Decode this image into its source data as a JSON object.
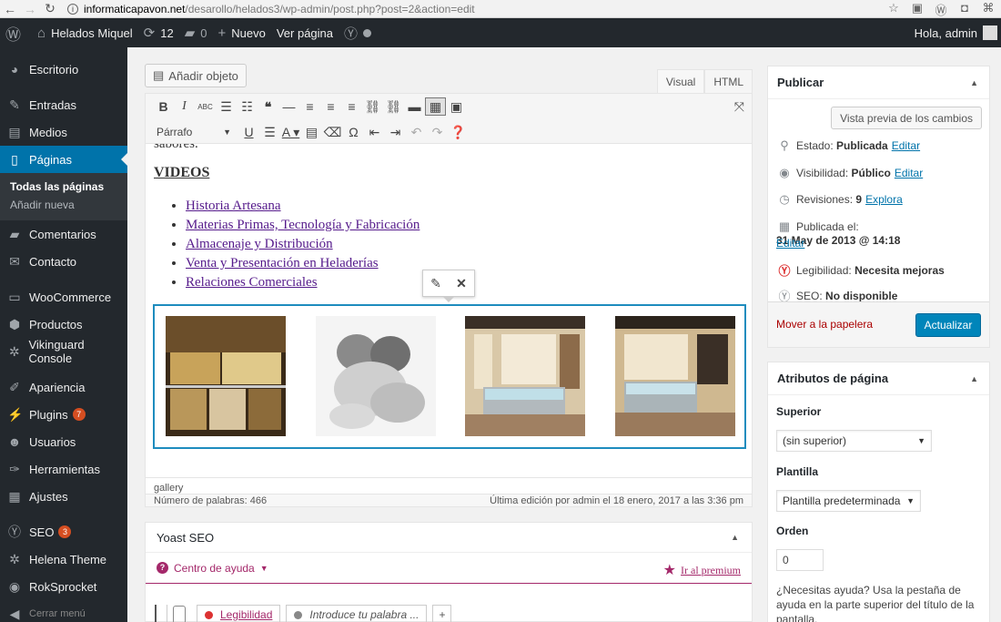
{
  "browser": {
    "url_host": "informaticapavon.net",
    "url_path": "/desarollo/helados3/wp-admin/post.php?post=2&action=edit"
  },
  "adminbar": {
    "site_name": "Helados Miquel",
    "updates_count": "12",
    "comments_count": "0",
    "new_label": "Nuevo",
    "view_page_label": "Ver página",
    "greeting": "Hola, admin"
  },
  "sidebar": {
    "items": [
      {
        "label": "Escritorio",
        "icon": "dashboard-icon"
      },
      {
        "label": "Entradas",
        "icon": "pin-icon"
      },
      {
        "label": "Medios",
        "icon": "media-icon"
      },
      {
        "label": "Páginas",
        "icon": "pages-icon"
      },
      {
        "label": "Comentarios",
        "icon": "comments-icon"
      },
      {
        "label": "Contacto",
        "icon": "mail-icon"
      },
      {
        "label": "WooCommerce",
        "icon": "woo-icon"
      },
      {
        "label": "Productos",
        "icon": "products-icon"
      },
      {
        "label": "Vikinguard Console",
        "icon": "gear-icon"
      },
      {
        "label": "Apariencia",
        "icon": "brush-icon"
      },
      {
        "label": "Plugins",
        "icon": "plugin-icon",
        "badge": "7"
      },
      {
        "label": "Usuarios",
        "icon": "users-icon"
      },
      {
        "label": "Herramientas",
        "icon": "tools-icon"
      },
      {
        "label": "Ajustes",
        "icon": "settings-icon"
      },
      {
        "label": "SEO",
        "icon": "yoast-icon",
        "badge": "3"
      },
      {
        "label": "Helena Theme",
        "icon": "gear-icon"
      },
      {
        "label": "RokSprocket",
        "icon": "rocket-icon"
      },
      {
        "label": "Cerrar menú",
        "icon": "collapse-icon"
      }
    ],
    "submenu": [
      "Todas las páginas",
      "Añadir nueva"
    ]
  },
  "editor": {
    "add_media_label": "Añadir objeto",
    "tab_visual": "Visual",
    "tab_html": "HTML",
    "format_select": "Párrafo",
    "cut_text": "sabores.",
    "heading": "VIDEOS",
    "links": [
      "Historia Artesana",
      "Materias Primas, Tecnología y Fabricación",
      "Almacenaje y Distribución",
      "Venta y Presentación en Heladerías",
      "Relaciones Comerciales"
    ],
    "path_label": "gallery",
    "word_count": "Número de palabras: 466",
    "last_edit": "Última edición por admin el 18 enero, 2017 a las 3:36 pm"
  },
  "yoast": {
    "title": "Yoast SEO",
    "help_label": "Centro de ayuda",
    "premium_label": "Ir al premium",
    "tab_readability": "Legibilidad",
    "tab_keyword": "Introduce tu palabra ...",
    "add_label": "+"
  },
  "publish": {
    "title": "Publicar",
    "preview_button": "Vista previa de los cambios",
    "status_label": "Estado:",
    "status_value": "Publicada",
    "visibility_label": "Visibilidad:",
    "visibility_value": "Público",
    "revisions_label": "Revisiones:",
    "revisions_value": "9",
    "revisions_link": "Explora",
    "published_label": "Publicada el:",
    "published_value": "31 May de 2013 @ 14:18",
    "edit_link": "Editar",
    "readability_label": "Legibilidad:",
    "readability_value": "Necesita mejoras",
    "seo_label": "SEO:",
    "seo_value": "No disponible",
    "trash_link": "Mover a la papelera",
    "update_button": "Actualizar"
  },
  "page_attributes": {
    "title": "Atributos de página",
    "parent_label": "Superior",
    "parent_value": "(sin superior)",
    "template_label": "Plantilla",
    "template_value": "Plantilla predeterminada",
    "order_label": "Orden",
    "order_value": "0",
    "help_text": "¿Necesitas ayuda? Usa la pestaña de ayuda en la parte superior del título de la pantalla."
  },
  "colors": {
    "admin_dark": "#23282d",
    "accent_blue": "#0073aa",
    "yoast_purple": "#a4286a",
    "badge_orange": "#d54e21"
  }
}
